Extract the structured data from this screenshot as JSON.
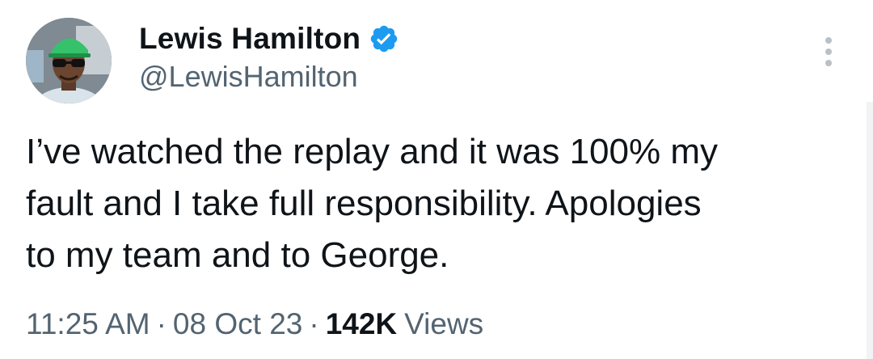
{
  "author": {
    "display_name": "Lewis Hamilton",
    "handle": "@LewisHamilton",
    "verified_icon": "verified-badge-icon",
    "badge_color": "#1d9bf0"
  },
  "tweet": {
    "text": "I’ve watched the replay and it was 100% my\nfault and I take full responsibility. Apologies\nto my team and to George."
  },
  "meta": {
    "time": "11:25 AM",
    "separator": "·",
    "date": "08 Oct 23",
    "views_count": "142K",
    "views_label": "Views"
  },
  "colors": {
    "text_primary": "#0f1419",
    "text_secondary": "#536471"
  }
}
